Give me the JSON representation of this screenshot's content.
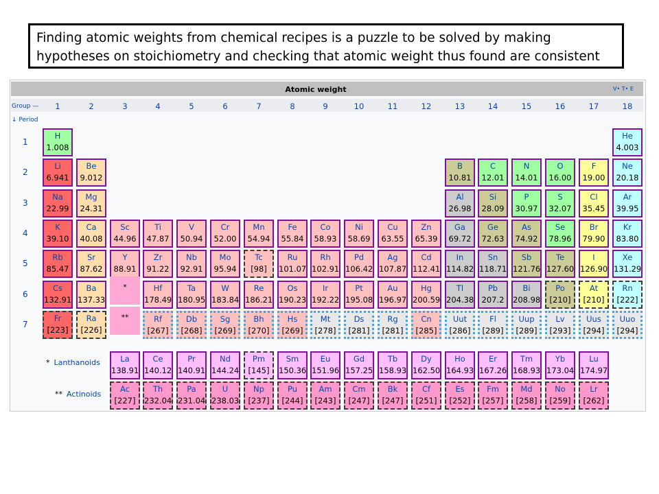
{
  "caption": {
    "line1": "Finding atomic weights from chemical recipes is a puzzle to be solved by making",
    "line2": "hypotheses on stoichiometry and checking that atomic weight thus found are consistent"
  },
  "table": {
    "title": "Atomic weight",
    "vte": "V• T• E",
    "group_label": "Group —",
    "period_label": "↓ Period",
    "groups": [
      "1",
      "2",
      "3",
      "4",
      "5",
      "6",
      "7",
      "8",
      "9",
      "10",
      "11",
      "12",
      "13",
      "14",
      "15",
      "16",
      "17",
      "18"
    ],
    "periods": [
      "1",
      "2",
      "3",
      "4",
      "5",
      "6",
      "7"
    ],
    "markers": {
      "lanthanoid": "*",
      "actinoid": "**"
    },
    "lanthanoids_label": "Lanthanoids",
    "actinoids_label": "Actinoids",
    "lanthanoids_prefix": "*",
    "actinoids_prefix": "**"
  },
  "colors": {
    "alkali": "#ff6666",
    "alkaline_earth": "#ffdead",
    "lanthanoid": "#ffbfff",
    "actinoid": "#ff99cc",
    "transition": "#ffc0c0",
    "post_transition": "#cccccc",
    "metalloid": "#cccc99",
    "other_nonmetal": "#a0ffa0",
    "halogen": "#ffff99",
    "noble_gas": "#c0ffff",
    "unknown": "#e8e8e8",
    "cell_border": "#7f0f9e"
  },
  "elements": [
    {
      "s": "H",
      "w": "1.008",
      "r": 1,
      "c": 1,
      "t": "other_nonmetal",
      "b": "solid"
    },
    {
      "s": "He",
      "w": "4.003",
      "r": 1,
      "c": 18,
      "t": "noble_gas",
      "b": "solid"
    },
    {
      "s": "Li",
      "w": "6.941",
      "r": 2,
      "c": 1,
      "t": "alkali",
      "b": "solid"
    },
    {
      "s": "Be",
      "w": "9.012",
      "r": 2,
      "c": 2,
      "t": "alkaline_earth",
      "b": "solid"
    },
    {
      "s": "B",
      "w": "10.81",
      "r": 2,
      "c": 13,
      "t": "metalloid",
      "b": "solid"
    },
    {
      "s": "C",
      "w": "12.01",
      "r": 2,
      "c": 14,
      "t": "other_nonmetal",
      "b": "solid"
    },
    {
      "s": "N",
      "w": "14.01",
      "r": 2,
      "c": 15,
      "t": "other_nonmetal",
      "b": "solid"
    },
    {
      "s": "O",
      "w": "16.00",
      "r": 2,
      "c": 16,
      "t": "other_nonmetal",
      "b": "solid"
    },
    {
      "s": "F",
      "w": "19.00",
      "r": 2,
      "c": 17,
      "t": "halogen",
      "b": "solid"
    },
    {
      "s": "Ne",
      "w": "20.18",
      "r": 2,
      "c": 18,
      "t": "noble_gas",
      "b": "solid"
    },
    {
      "s": "Na",
      "w": "22.99",
      "r": 3,
      "c": 1,
      "t": "alkali",
      "b": "solid"
    },
    {
      "s": "Mg",
      "w": "24.31",
      "r": 3,
      "c": 2,
      "t": "alkaline_earth",
      "b": "solid"
    },
    {
      "s": "Al",
      "w": "26.98",
      "r": 3,
      "c": 13,
      "t": "post_transition",
      "b": "solid"
    },
    {
      "s": "Si",
      "w": "28.09",
      "r": 3,
      "c": 14,
      "t": "metalloid",
      "b": "solid"
    },
    {
      "s": "P",
      "w": "30.97",
      "r": 3,
      "c": 15,
      "t": "other_nonmetal",
      "b": "solid"
    },
    {
      "s": "S",
      "w": "32.07",
      "r": 3,
      "c": 16,
      "t": "other_nonmetal",
      "b": "solid"
    },
    {
      "s": "Cl",
      "w": "35.45",
      "r": 3,
      "c": 17,
      "t": "halogen",
      "b": "solid"
    },
    {
      "s": "Ar",
      "w": "39.95",
      "r": 3,
      "c": 18,
      "t": "noble_gas",
      "b": "solid"
    },
    {
      "s": "K",
      "w": "39.10",
      "r": 4,
      "c": 1,
      "t": "alkali",
      "b": "solid"
    },
    {
      "s": "Ca",
      "w": "40.08",
      "r": 4,
      "c": 2,
      "t": "alkaline_earth",
      "b": "solid"
    },
    {
      "s": "Sc",
      "w": "44.96",
      "r": 4,
      "c": 3,
      "t": "transition",
      "b": "solid"
    },
    {
      "s": "Ti",
      "w": "47.87",
      "r": 4,
      "c": 4,
      "t": "transition",
      "b": "solid"
    },
    {
      "s": "V",
      "w": "50.94",
      "r": 4,
      "c": 5,
      "t": "transition",
      "b": "solid"
    },
    {
      "s": "Cr",
      "w": "52.00",
      "r": 4,
      "c": 6,
      "t": "transition",
      "b": "solid"
    },
    {
      "s": "Mn",
      "w": "54.94",
      "r": 4,
      "c": 7,
      "t": "transition",
      "b": "solid"
    },
    {
      "s": "Fe",
      "w": "55.84",
      "r": 4,
      "c": 8,
      "t": "transition",
      "b": "solid"
    },
    {
      "s": "Co",
      "w": "58.93",
      "r": 4,
      "c": 9,
      "t": "transition",
      "b": "solid"
    },
    {
      "s": "Ni",
      "w": "58.69",
      "r": 4,
      "c": 10,
      "t": "transition",
      "b": "solid"
    },
    {
      "s": "Cu",
      "w": "63.55",
      "r": 4,
      "c": 11,
      "t": "transition",
      "b": "solid"
    },
    {
      "s": "Zn",
      "w": "65.39",
      "r": 4,
      "c": 12,
      "t": "transition",
      "b": "solid"
    },
    {
      "s": "Ga",
      "w": "69.72",
      "r": 4,
      "c": 13,
      "t": "post_transition",
      "b": "solid"
    },
    {
      "s": "Ge",
      "w": "72.63",
      "r": 4,
      "c": 14,
      "t": "metalloid",
      "b": "solid"
    },
    {
      "s": "As",
      "w": "74.92",
      "r": 4,
      "c": 15,
      "t": "metalloid",
      "b": "solid"
    },
    {
      "s": "Se",
      "w": "78.96",
      "r": 4,
      "c": 16,
      "t": "other_nonmetal",
      "b": "solid"
    },
    {
      "s": "Br",
      "w": "79.90",
      "r": 4,
      "c": 17,
      "t": "halogen",
      "b": "solid"
    },
    {
      "s": "Kr",
      "w": "83.80",
      "r": 4,
      "c": 18,
      "t": "noble_gas",
      "b": "solid"
    },
    {
      "s": "Rb",
      "w": "85.47",
      "r": 5,
      "c": 1,
      "t": "alkali",
      "b": "solid"
    },
    {
      "s": "Sr",
      "w": "87.62",
      "r": 5,
      "c": 2,
      "t": "alkaline_earth",
      "b": "solid"
    },
    {
      "s": "Y",
      "w": "88.91",
      "r": 5,
      "c": 3,
      "t": "transition",
      "b": "solid"
    },
    {
      "s": "Zr",
      "w": "91.22",
      "r": 5,
      "c": 4,
      "t": "transition",
      "b": "solid"
    },
    {
      "s": "Nb",
      "w": "92.91",
      "r": 5,
      "c": 5,
      "t": "transition",
      "b": "solid"
    },
    {
      "s": "Mo",
      "w": "95.94",
      "r": 5,
      "c": 6,
      "t": "transition",
      "b": "solid"
    },
    {
      "s": "Tc",
      "w": "[98]",
      "r": 5,
      "c": 7,
      "t": "transition",
      "b": "dashed"
    },
    {
      "s": "Ru",
      "w": "101.07",
      "r": 5,
      "c": 8,
      "t": "transition",
      "b": "solid"
    },
    {
      "s": "Rh",
      "w": "102.91",
      "r": 5,
      "c": 9,
      "t": "transition",
      "b": "solid"
    },
    {
      "s": "Pd",
      "w": "106.42",
      "r": 5,
      "c": 10,
      "t": "transition",
      "b": "solid"
    },
    {
      "s": "Ag",
      "w": "107.87",
      "r": 5,
      "c": 11,
      "t": "transition",
      "b": "solid"
    },
    {
      "s": "Cd",
      "w": "112.41",
      "r": 5,
      "c": 12,
      "t": "transition",
      "b": "solid"
    },
    {
      "s": "In",
      "w": "114.82",
      "r": 5,
      "c": 13,
      "t": "post_transition",
      "b": "solid"
    },
    {
      "s": "Sn",
      "w": "118.71",
      "r": 5,
      "c": 14,
      "t": "post_transition",
      "b": "solid"
    },
    {
      "s": "Sb",
      "w": "121.76",
      "r": 5,
      "c": 15,
      "t": "metalloid",
      "b": "solid"
    },
    {
      "s": "Te",
      "w": "127.60",
      "r": 5,
      "c": 16,
      "t": "metalloid",
      "b": "solid"
    },
    {
      "s": "I",
      "w": "126.90",
      "r": 5,
      "c": 17,
      "t": "halogen",
      "b": "solid"
    },
    {
      "s": "Xe",
      "w": "131.29",
      "r": 5,
      "c": 18,
      "t": "noble_gas",
      "b": "solid"
    },
    {
      "s": "Cs",
      "w": "132.91",
      "r": 6,
      "c": 1,
      "t": "alkali",
      "b": "solid"
    },
    {
      "s": "Ba",
      "w": "137.33",
      "r": 6,
      "c": 2,
      "t": "alkaline_earth",
      "b": "solid"
    },
    {
      "s": "Hf",
      "w": "178.49",
      "r": 6,
      "c": 4,
      "t": "transition",
      "b": "solid"
    },
    {
      "s": "Ta",
      "w": "180.95",
      "r": 6,
      "c": 5,
      "t": "transition",
      "b": "solid"
    },
    {
      "s": "W",
      "w": "183.84",
      "r": 6,
      "c": 6,
      "t": "transition",
      "b": "solid"
    },
    {
      "s": "Re",
      "w": "186.21",
      "r": 6,
      "c": 7,
      "t": "transition",
      "b": "solid"
    },
    {
      "s": "Os",
      "w": "190.23",
      "r": 6,
      "c": 8,
      "t": "transition",
      "b": "solid"
    },
    {
      "s": "Ir",
      "w": "192.22",
      "r": 6,
      "c": 9,
      "t": "transition",
      "b": "solid"
    },
    {
      "s": "Pt",
      "w": "195.08",
      "r": 6,
      "c": 10,
      "t": "transition",
      "b": "solid"
    },
    {
      "s": "Au",
      "w": "196.97",
      "r": 6,
      "c": 11,
      "t": "transition",
      "b": "solid"
    },
    {
      "s": "Hg",
      "w": "200.59",
      "r": 6,
      "c": 12,
      "t": "transition",
      "b": "solid"
    },
    {
      "s": "Tl",
      "w": "204.38",
      "r": 6,
      "c": 13,
      "t": "post_transition",
      "b": "solid"
    },
    {
      "s": "Pb",
      "w": "207.2",
      "r": 6,
      "c": 14,
      "t": "post_transition",
      "b": "solid"
    },
    {
      "s": "Bi",
      "w": "208.98",
      "r": 6,
      "c": 15,
      "t": "post_transition",
      "b": "solid"
    },
    {
      "s": "Po",
      "w": "[210]",
      "r": 6,
      "c": 16,
      "t": "metalloid",
      "b": "dashed"
    },
    {
      "s": "At",
      "w": "[210]",
      "r": 6,
      "c": 17,
      "t": "halogen",
      "b": "dashed"
    },
    {
      "s": "Rn",
      "w": "[222]",
      "r": 6,
      "c": 18,
      "t": "noble_gas",
      "b": "dashed"
    },
    {
      "s": "Fr",
      "w": "[223]",
      "r": 7,
      "c": 1,
      "t": "alkali",
      "b": "dashed"
    },
    {
      "s": "Ra",
      "w": "[226]",
      "r": 7,
      "c": 2,
      "t": "alkaline_earth",
      "b": "dashed"
    },
    {
      "s": "Rf",
      "w": "[267]",
      "r": 7,
      "c": 4,
      "t": "transition",
      "b": "dotted"
    },
    {
      "s": "Db",
      "w": "[268]",
      "r": 7,
      "c": 5,
      "t": "transition",
      "b": "dotted"
    },
    {
      "s": "Sg",
      "w": "[269]",
      "r": 7,
      "c": 6,
      "t": "transition",
      "b": "dotted"
    },
    {
      "s": "Bh",
      "w": "[270]",
      "r": 7,
      "c": 7,
      "t": "transition",
      "b": "dotted"
    },
    {
      "s": "Hs",
      "w": "[269]",
      "r": 7,
      "c": 8,
      "t": "transition",
      "b": "dotted"
    },
    {
      "s": "Mt",
      "w": "[278]",
      "r": 7,
      "c": 9,
      "t": "unknown",
      "b": "dotted"
    },
    {
      "s": "Ds",
      "w": "[281]",
      "r": 7,
      "c": 10,
      "t": "unknown",
      "b": "dotted"
    },
    {
      "s": "Rg",
      "w": "[281]",
      "r": 7,
      "c": 11,
      "t": "unknown",
      "b": "dotted"
    },
    {
      "s": "Cn",
      "w": "[285]",
      "r": 7,
      "c": 12,
      "t": "transition",
      "b": "dotted"
    },
    {
      "s": "Uut",
      "w": "[286]",
      "r": 7,
      "c": 13,
      "t": "unknown",
      "b": "dotted"
    },
    {
      "s": "Fl",
      "w": "[289]",
      "r": 7,
      "c": 14,
      "t": "unknown",
      "b": "dotted"
    },
    {
      "s": "Uup",
      "w": "[289]",
      "r": 7,
      "c": 15,
      "t": "unknown",
      "b": "dotted"
    },
    {
      "s": "Lv",
      "w": "[293]",
      "r": 7,
      "c": 16,
      "t": "unknown",
      "b": "dotted"
    },
    {
      "s": "Uus",
      "w": "[294]",
      "r": 7,
      "c": 17,
      "t": "unknown",
      "b": "dotted"
    },
    {
      "s": "Uuo",
      "w": "[294]",
      "r": 7,
      "c": 18,
      "t": "unknown",
      "b": "dotted"
    }
  ],
  "lanthanoids": [
    {
      "s": "La",
      "w": "138.91",
      "t": "lanthanoid",
      "b": "solid"
    },
    {
      "s": "Ce",
      "w": "140.12",
      "t": "lanthanoid",
      "b": "solid"
    },
    {
      "s": "Pr",
      "w": "140.91",
      "t": "lanthanoid",
      "b": "solid"
    },
    {
      "s": "Nd",
      "w": "144.24",
      "t": "lanthanoid",
      "b": "solid"
    },
    {
      "s": "Pm",
      "w": "[145]",
      "t": "lanthanoid",
      "b": "dashed"
    },
    {
      "s": "Sm",
      "w": "150.36",
      "t": "lanthanoid",
      "b": "solid"
    },
    {
      "s": "Eu",
      "w": "151.96",
      "t": "lanthanoid",
      "b": "solid"
    },
    {
      "s": "Gd",
      "w": "157.25",
      "t": "lanthanoid",
      "b": "solid"
    },
    {
      "s": "Tb",
      "w": "158.93",
      "t": "lanthanoid",
      "b": "solid"
    },
    {
      "s": "Dy",
      "w": "162.50",
      "t": "lanthanoid",
      "b": "solid"
    },
    {
      "s": "Ho",
      "w": "164.93",
      "t": "lanthanoid",
      "b": "solid"
    },
    {
      "s": "Er",
      "w": "167.26",
      "t": "lanthanoid",
      "b": "solid"
    },
    {
      "s": "Tm",
      "w": "168.93",
      "t": "lanthanoid",
      "b": "solid"
    },
    {
      "s": "Yb",
      "w": "173.04",
      "t": "lanthanoid",
      "b": "solid"
    },
    {
      "s": "Lu",
      "w": "174.97",
      "t": "lanthanoid",
      "b": "solid"
    }
  ],
  "actinoids": [
    {
      "s": "Ac",
      "w": "[227]",
      "t": "actinoid",
      "b": "dashed"
    },
    {
      "s": "Th",
      "w": "232.04",
      "t": "actinoid",
      "b": "dashed"
    },
    {
      "s": "Pa",
      "w": "231.04",
      "t": "actinoid",
      "b": "dashed"
    },
    {
      "s": "U",
      "w": "238.03",
      "t": "actinoid",
      "b": "dashed"
    },
    {
      "s": "Np",
      "w": "[237]",
      "t": "actinoid",
      "b": "dashed"
    },
    {
      "s": "Pu",
      "w": "[244]",
      "t": "actinoid",
      "b": "dashed"
    },
    {
      "s": "Am",
      "w": "[243]",
      "t": "actinoid",
      "b": "dashed"
    },
    {
      "s": "Cm",
      "w": "[247]",
      "t": "actinoid",
      "b": "dashed"
    },
    {
      "s": "Bk",
      "w": "[247]",
      "t": "actinoid",
      "b": "dashed"
    },
    {
      "s": "Cf",
      "w": "[251]",
      "t": "actinoid",
      "b": "dashed"
    },
    {
      "s": "Es",
      "w": "[252]",
      "t": "actinoid",
      "b": "dashed"
    },
    {
      "s": "Fm",
      "w": "[257]",
      "t": "actinoid",
      "b": "dashed"
    },
    {
      "s": "Md",
      "w": "[258]",
      "t": "actinoid",
      "b": "dashed"
    },
    {
      "s": "No",
      "w": "[259]",
      "t": "actinoid",
      "b": "dashed"
    },
    {
      "s": "Lr",
      "w": "[262]",
      "t": "actinoid",
      "b": "dashed"
    }
  ]
}
